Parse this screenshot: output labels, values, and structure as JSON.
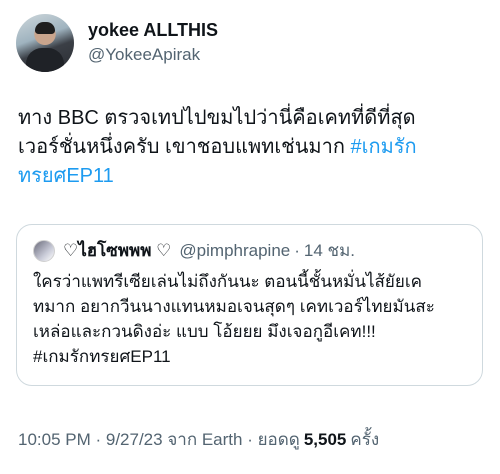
{
  "author": {
    "display_name": "yokee ALLTHIS",
    "handle": "@YokeeApirak"
  },
  "tweet": {
    "text": "ทาง BBC ตรวจเทปไปขมไปว่านี่คือเคทที่ดีที่สุด\nเวอร์ชั่นหนึ่งครับ เขาชอบแพทเช่นมาก ",
    "hashtag_line1": "#เกมรัก",
    "hashtag_line2": "ทรยศEP11"
  },
  "quoted": {
    "display_name": "♡ไฮโซพพพ ♡",
    "handle": "@pimphrapine",
    "separator": "·",
    "time": "14 ชม.",
    "text": "ใครว่าแพทรีเซียเล่นไม่ถึงกันนะ ตอนนี้ชั้นหมั่นไส้ยัยเค\nทมาก อยากวีนนางแทนหมอเจนสุดๆ เคทเวอร์ไทยมันสะ\nเหล่อและกวนดิงอ่ะ แบบ โอ้ยยย  มึงเจอกูอีเคท!!!\n#เกมรักทรยศEP11"
  },
  "meta": {
    "timestamp": "10:05 PM · 9/27/23 จาก Earth · ยอดดู",
    "views": "5,505",
    "views_label": "ครั้ง"
  },
  "colors": {
    "hashtag": "#1d9bf0",
    "secondary_text": "#536471",
    "border": "#cfd9de"
  }
}
